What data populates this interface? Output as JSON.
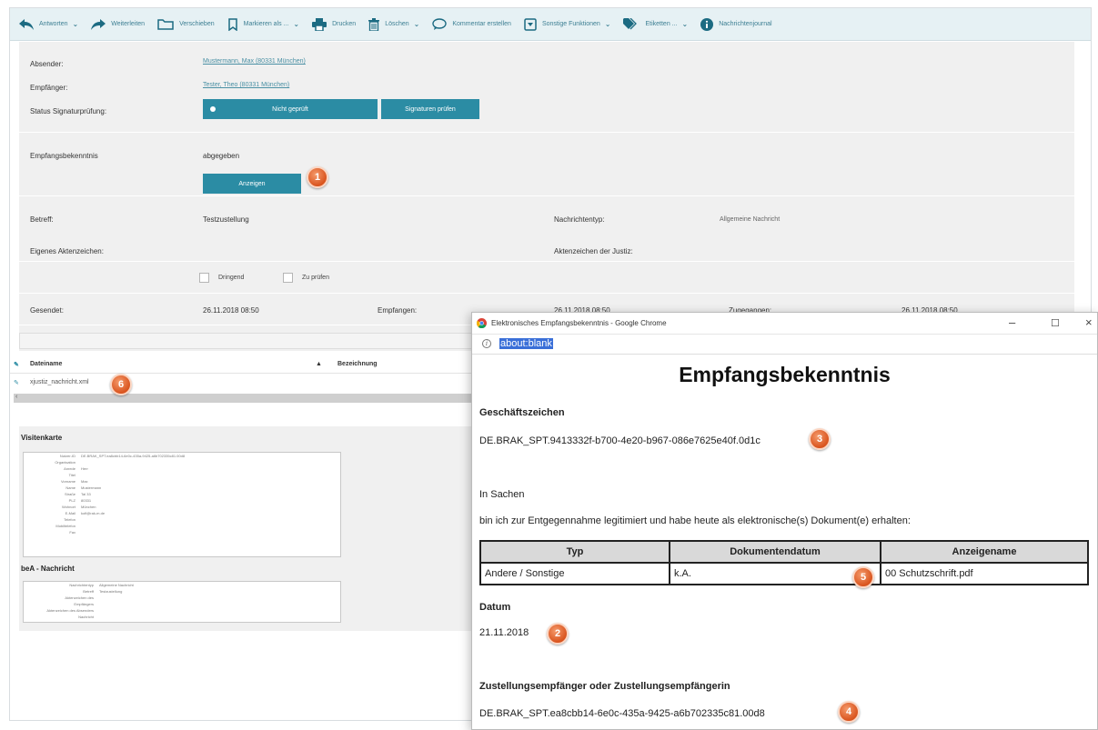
{
  "toolbar": {
    "items": [
      {
        "label": "Antworten",
        "icon": "reply-icon",
        "caret": true
      },
      {
        "label": "Weiterleiten",
        "icon": "forward-icon",
        "caret": false
      },
      {
        "label": "Verschieben",
        "icon": "folder-icon",
        "caret": false
      },
      {
        "label": "Markieren als ...",
        "icon": "bookmark-icon",
        "caret": true
      },
      {
        "label": "Drucken",
        "icon": "print-icon",
        "caret": false
      },
      {
        "label": "Löschen",
        "icon": "trash-icon",
        "caret": true
      },
      {
        "label": "Kommentar erstellen",
        "icon": "comment-icon",
        "caret": false
      },
      {
        "label": "Sonstige Funktionen",
        "icon": "menu-box-icon",
        "caret": true
      },
      {
        "label": "Etiketten ...",
        "icon": "tag-icon",
        "caret": true
      },
      {
        "label": "Nachrichtenjournal",
        "icon": "info-icon",
        "caret": false
      }
    ]
  },
  "message": {
    "sender_label": "Absender:",
    "sender_value": "Mustermann, Max (80331 München)",
    "recipient_label": "Empfänger:",
    "recipient_value": "Tester, Theo (80331 München)",
    "signature_label": "Status Signaturprüfung:",
    "signature_status": "Nicht geprüft",
    "signature_check_button": "Signaturen prüfen",
    "receipt_label": "Empfangsbekenntnis",
    "receipt_value": "abgegeben",
    "receipt_show_button": "Anzeigen",
    "subject_label": "Betreff:",
    "subject_value": "Testzustellung",
    "type_label": "Nachrichtentyp:",
    "type_value": "Allgemeine Nachricht",
    "own_ref_label": "Eigenes Aktenzeichen:",
    "court_ref_label": "Aktenzeichen der Justiz:",
    "urgent_label": "Dringend",
    "review_label": "Zu prüfen",
    "sent_label": "Gesendet:",
    "sent_value": "26.11.2018 08:50",
    "received_label": "Empfangen:",
    "received_value": "26.11.2018 08:50",
    "delivered_label": "Zugegangen:",
    "delivered_value": "26.11.2018 08:50"
  },
  "files": {
    "col_filename": "Dateiname",
    "col_description": "Bezeichnung",
    "rows": [
      {
        "filename": "xjustiz_nachricht.xml"
      }
    ]
  },
  "visitenkarte": {
    "title": "Visitenkarte",
    "rows": [
      {
        "k": "Nutzer-ID",
        "v": "DE.BRAK_SPT.ea8cbb14-6e0c-435a-9425-a6b702335c81.00d8"
      },
      {
        "k": "Organisation",
        "v": ""
      },
      {
        "k": "Anrede",
        "v": "Herr"
      },
      {
        "k": "Titel",
        "v": ""
      },
      {
        "k": "Vorname",
        "v": "Max"
      },
      {
        "k": "Name",
        "v": "Mustermann"
      },
      {
        "k": "Straße",
        "v": "Tal 33"
      },
      {
        "k": "PLZ",
        "v": "80331"
      },
      {
        "k": "Wohnort",
        "v": "München"
      },
      {
        "k": "E-Mail",
        "v": "kofi@rak-m.de"
      },
      {
        "k": "Telefon",
        "v": ""
      },
      {
        "k": "Mobiltelefon",
        "v": ""
      },
      {
        "k": "Fax",
        "v": ""
      }
    ]
  },
  "bea": {
    "title": "beA - Nachricht",
    "rows": [
      {
        "k": "Nachrichtentyp",
        "v": "Allgemeine Nachricht"
      },
      {
        "k": "Betreff",
        "v": "Testzustellung"
      },
      {
        "k": "Aktenzeichen des Empfängers",
        "v": ""
      },
      {
        "k": "Aktenzeichen des Absenders",
        "v": ""
      },
      {
        "k": "Nachricht",
        "v": ""
      }
    ]
  },
  "popup": {
    "window_title": "Elektronisches Empfangsbekenntnis - Google Chrome",
    "url": "about:blank",
    "heading": "Empfangsbekenntnis",
    "geschaeftszeichen_label": "Geschäftszeichen",
    "geschaeftszeichen_value": "DE.BRAK_SPT.9413332f-b700-4e20-b967-086e7625e40f.0d1c",
    "in_sachen": "In Sachen",
    "statement": "bin ich zur Entgegennahme legitimiert und habe heute als elektronische(s) Dokument(e) erhalten:",
    "table_headers": [
      "Typ",
      "Dokumentendatum",
      "Anzeigename"
    ],
    "table_row": [
      "Andere / Sonstige",
      "k.A.",
      "00 Schutzschrift.pdf"
    ],
    "datum_label": "Datum",
    "datum_value": "21.11.2018",
    "zustellung_label": "Zustellungsempfänger oder Zustellungsempfängerin",
    "zustellung_value": "DE.BRAK_SPT.ea8cbb14-6e0c-435a-9425-a6b702335c81.00d8"
  },
  "badges": [
    "1",
    "2",
    "3",
    "4",
    "5",
    "6"
  ],
  "colors": {
    "accent": "#2b8ca4",
    "badge": "#e0612b",
    "toolbar_bg": "#e6f1f4"
  }
}
